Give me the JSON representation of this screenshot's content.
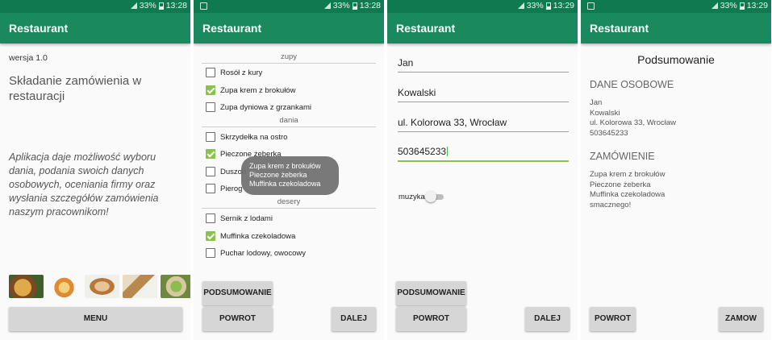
{
  "status": {
    "battery": "33%",
    "times": [
      "13:28",
      "13:28",
      "13:29",
      "13:29"
    ]
  },
  "app_title": "Restaurant",
  "screen1": {
    "version": "wersja 1.0",
    "heading": "Składanie zamówienia w restauracji",
    "description": "Aplikacja daje możliwość wyboru dania, podania swoich danych osobowych, oceniania firmy oraz wysłania szczegółów zamówienia naszym pracownikom!",
    "images": [
      "food-image-1",
      "food-image-2",
      "food-image-3",
      "food-image-4",
      "food-image-5"
    ],
    "menu_button": "MENU"
  },
  "screen2": {
    "sections": [
      {
        "title": "zupy",
        "items": [
          {
            "label": "Rosół z kury",
            "checked": false
          },
          {
            "label": "Zupa krem z brokułów",
            "checked": true
          },
          {
            "label": "Zupa dyniowa z grzankami",
            "checked": false
          }
        ]
      },
      {
        "title": "dania",
        "items": [
          {
            "label": "Skrzydełka na ostro",
            "checked": false
          },
          {
            "label": "Pieczone żeberka",
            "checked": true
          },
          {
            "label": "Duszon",
            "checked": false
          },
          {
            "label": "Pierog",
            "checked": false
          }
        ]
      },
      {
        "title": "desery",
        "items": [
          {
            "label": "Sernik z lodami",
            "checked": false
          },
          {
            "label": "Muffinka czekoladowa",
            "checked": true
          },
          {
            "label": "Puchar lodowy, owocowy",
            "checked": false
          }
        ]
      }
    ],
    "toast": [
      "Zupa krem z brokułów",
      "Pieczone żeberka",
      "Muffinka czekoladowa"
    ],
    "summary_button": "PODSUMOWANIE",
    "back_button": "POWROT",
    "next_button": "DALEJ"
  },
  "screen3": {
    "first_name": "Jan",
    "last_name": "Kowalski",
    "address": "ul. Kolorowa 33, Wrocław",
    "phone": "503645233",
    "music_label": "muzyka",
    "music_on": false,
    "summary_button": "PODSUMOWANIE",
    "back_button": "POWROT",
    "next_button": "DALEJ"
  },
  "screen4": {
    "title": "Podsumowanie",
    "personal_header": "DANE OSOBOWE",
    "personal_lines": [
      "Jan",
      "Kowalski",
      "ul. Kolorowa 33, Wrocław",
      "503645233"
    ],
    "order_header": "ZAMÓWIENIE",
    "order_lines": [
      "Zupa krem z brokułów",
      "Pieczone żeberka",
      "Muffinka czekoladowa",
      "smacznego!"
    ],
    "back_button": "POWROT",
    "order_button": "ZAMOW"
  },
  "colors": {
    "appbar": "#1a8a5e",
    "statusbar": "#0f7a4f",
    "accent": "#8bc34a"
  }
}
